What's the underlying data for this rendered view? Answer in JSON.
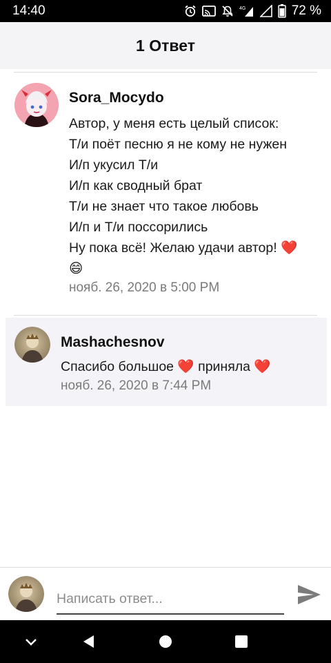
{
  "status_bar": {
    "time": "14:40",
    "battery_percent": "72 %",
    "icons": [
      "alarm-icon",
      "cast-icon",
      "bell-off-icon",
      "signal-4g-icon",
      "wifi-signal-icon",
      "battery-icon"
    ]
  },
  "header": {
    "title": "1 Ответ"
  },
  "comment": {
    "author": "Sora_Mocydo",
    "lines": [
      "Автор, у меня есть целый список:",
      "Т/и поёт песню я не кому не нужен",
      "И/п укусил Т/и",
      "И/п как сводный брат",
      "Т/и не знает что такое любовь",
      "И/п и Т/и поссорились",
      "Ну пока всё! Желаю удачи автор! ❤️",
      "😄"
    ],
    "timestamp": "нояб. 26, 2020 в 5:00 PM"
  },
  "reply": {
    "author": "Mashachesnov",
    "text": "Спасибо большое ❤️ приняла ❤️",
    "timestamp": "нояб. 26, 2020 в 7:44 PM"
  },
  "composer": {
    "placeholder": "Написать ответ...",
    "value": ""
  },
  "colors": {
    "header_bg": "#f4f4f6",
    "reply_bg": "#f4f3f7",
    "timestamp": "#7b7b7b",
    "heart": "#e0202a"
  }
}
